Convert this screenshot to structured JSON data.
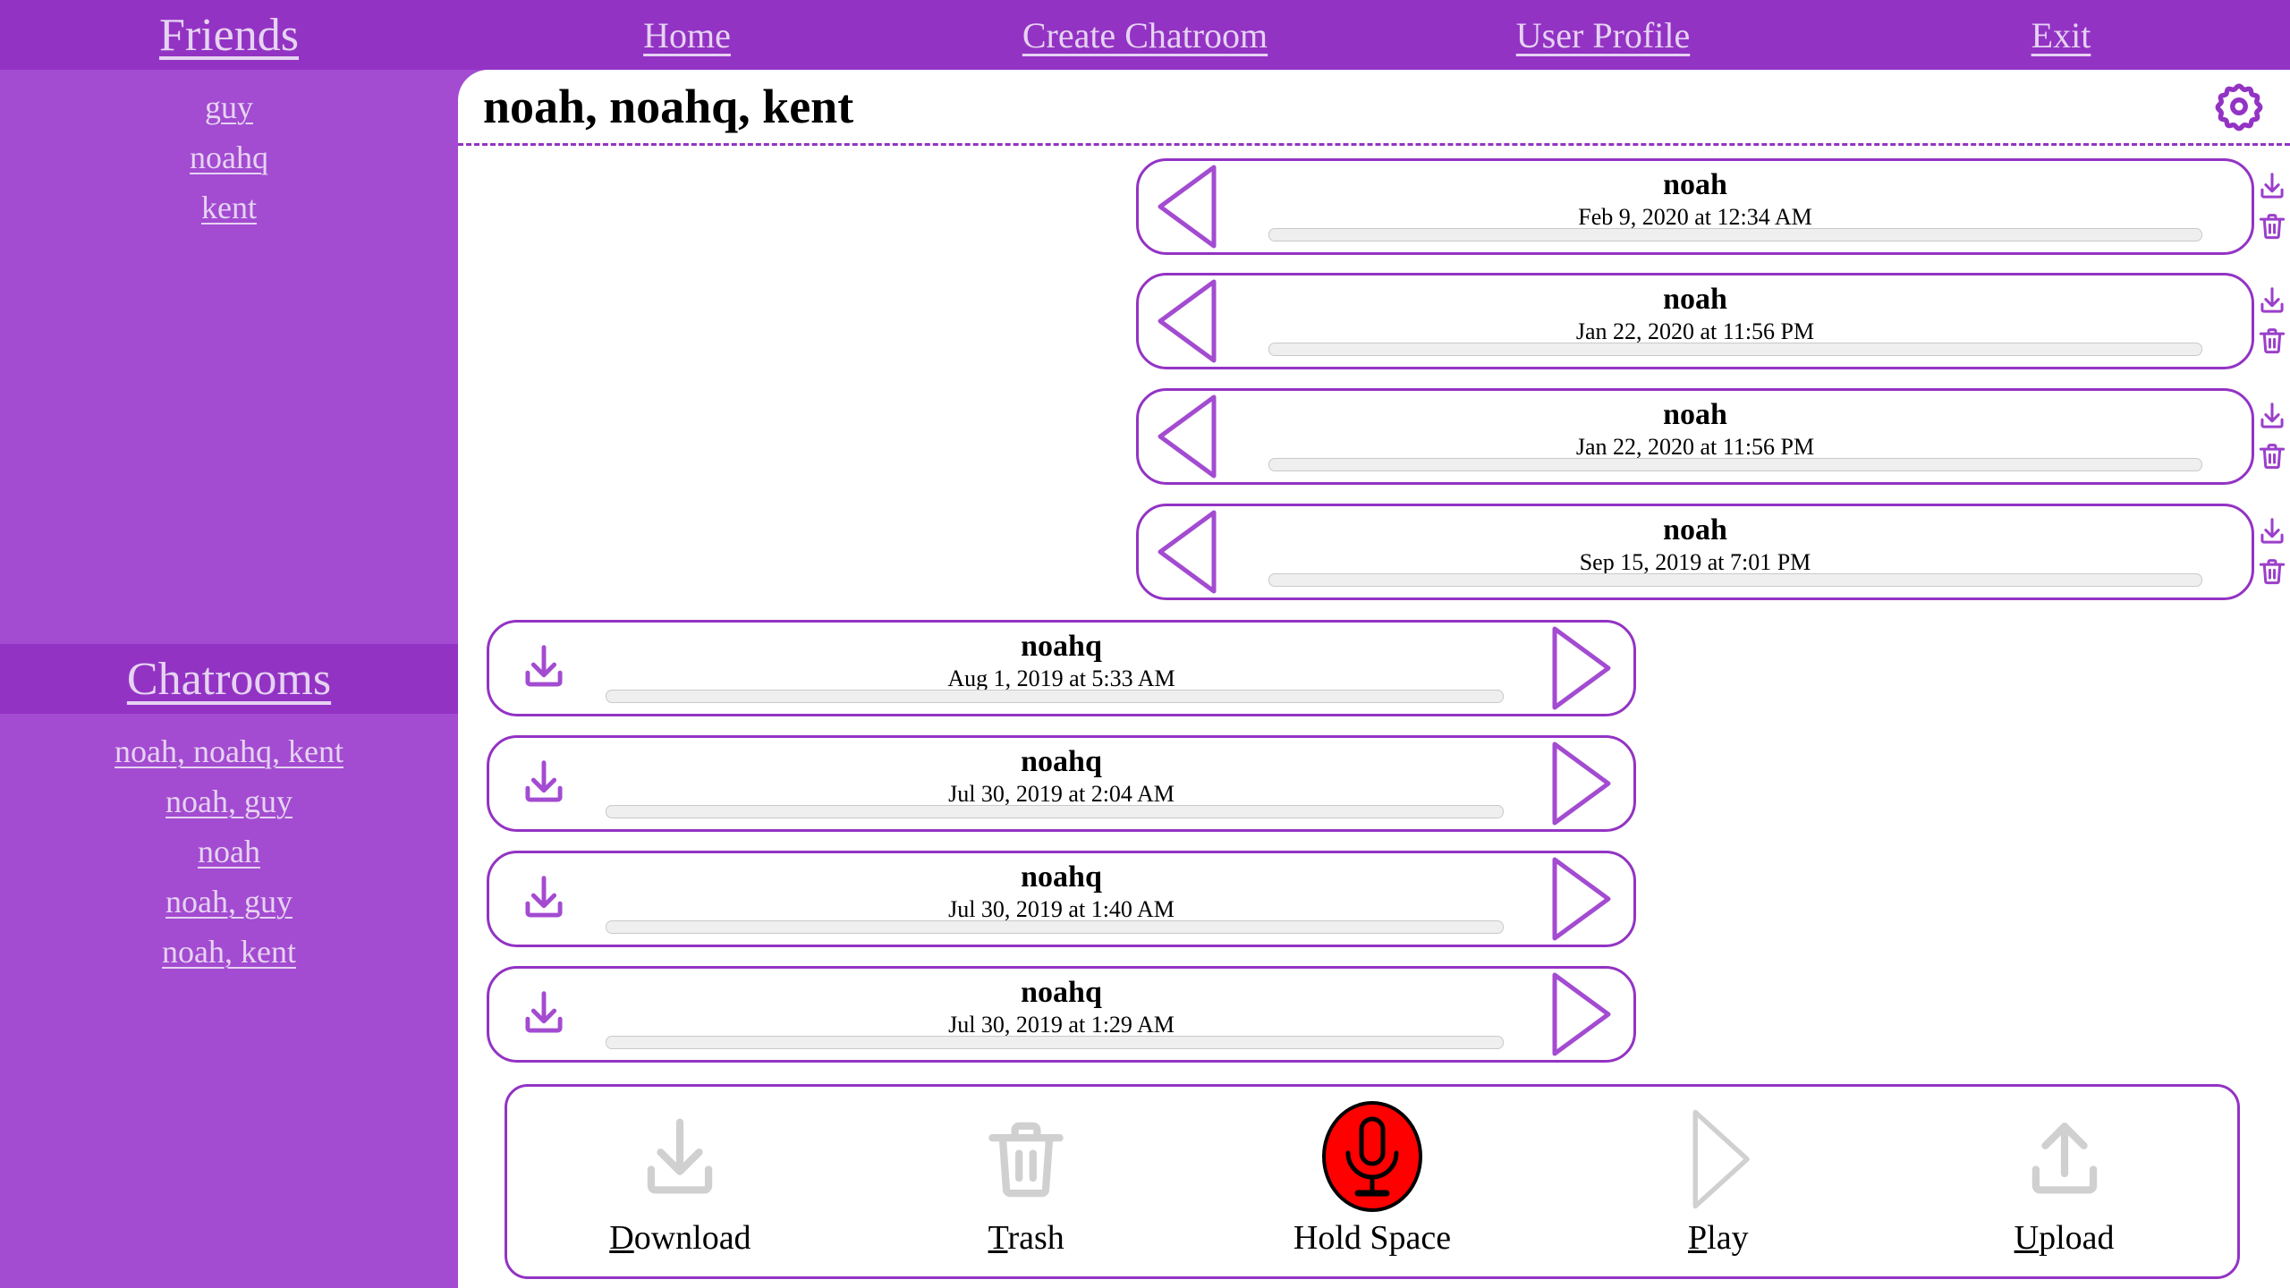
{
  "nav": {
    "items": [
      {
        "label": "Friends",
        "name": "nav-friends"
      },
      {
        "label": "Home",
        "name": "nav-home"
      },
      {
        "label": "Create Chatroom",
        "name": "nav-create-chatroom"
      },
      {
        "label": "User Profile",
        "name": "nav-user-profile"
      },
      {
        "label": "Exit",
        "name": "nav-exit"
      }
    ]
  },
  "sidebar": {
    "friends_header": "Friends",
    "friends": [
      "guy",
      "noahq",
      "kent"
    ],
    "chatrooms_header": "Chatrooms",
    "chatrooms": [
      "noah, noahq, kent",
      "noah, guy",
      "noah",
      "noah, guy",
      "noah, kent"
    ]
  },
  "panel": {
    "title": "noah, noahq, kent",
    "settings_icon": "gear-icon"
  },
  "messages": [
    {
      "sender": "noah",
      "timestamp": "Feb 9, 2020 at 12:34 AM",
      "direction": "incoming",
      "progress": 0
    },
    {
      "sender": "noah",
      "timestamp": "Jan 22, 2020 at 11:56 PM",
      "direction": "incoming",
      "progress": 0
    },
    {
      "sender": "noah",
      "timestamp": "Jan 22, 2020 at 11:56 PM",
      "direction": "incoming",
      "progress": 0
    },
    {
      "sender": "noah",
      "timestamp": "Sep 15, 2019 at 7:01 PM",
      "direction": "incoming",
      "progress": 0
    },
    {
      "sender": "noahq",
      "timestamp": "Aug 1, 2019 at 5:33 AM",
      "direction": "outgoing",
      "progress": 0
    },
    {
      "sender": "noahq",
      "timestamp": "Jul 30, 2019 at 2:04 AM",
      "direction": "outgoing",
      "progress": 0
    },
    {
      "sender": "noahq",
      "timestamp": "Jul 30, 2019 at 1:40 AM",
      "direction": "outgoing",
      "progress": 0
    },
    {
      "sender": "noahq",
      "timestamp": "Jul 30, 2019 at 1:29 AM",
      "direction": "outgoing",
      "progress": 0
    }
  ],
  "toolbar": {
    "buttons": [
      {
        "label": "Download",
        "accesskey": "D",
        "icon": "download-icon",
        "name": "download-button"
      },
      {
        "label": "Trash",
        "accesskey": "T",
        "icon": "trash-icon",
        "name": "trash-button"
      },
      {
        "label": "Hold Space",
        "accesskey": "",
        "icon": "microphone-icon",
        "name": "record-button"
      },
      {
        "label": "Play",
        "accesskey": "P",
        "icon": "play-icon",
        "name": "play-button"
      },
      {
        "label": "Upload",
        "accesskey": "U",
        "icon": "upload-icon",
        "name": "upload-button"
      }
    ]
  },
  "colors": {
    "nav_purple": "#9333c4",
    "sidebar_purple": "#a34bd1",
    "link_text": "#e6d3f2",
    "accent": "#9333c4",
    "record_red": "#ff0000",
    "tool_icon_gray": "#d0d0d0"
  }
}
